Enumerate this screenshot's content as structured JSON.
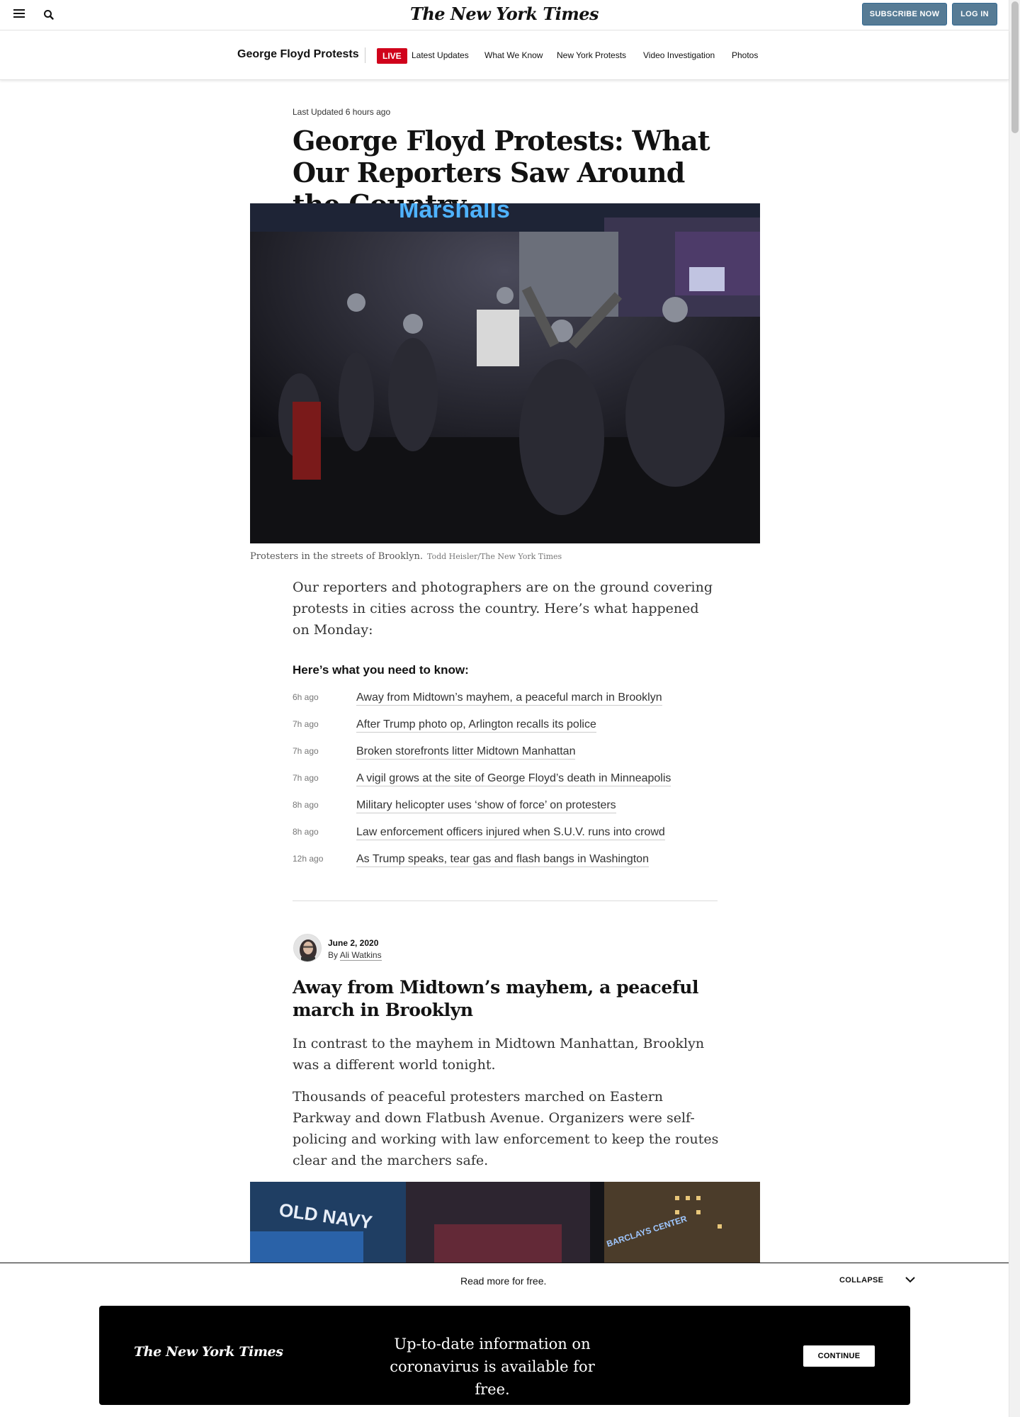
{
  "header": {
    "logo": "The New York Times",
    "subscribe_label": "SUBSCRIBE NOW",
    "login_label": "LOG IN"
  },
  "section_nav": {
    "title": "George Floyd Protests",
    "live_label": "LIVE",
    "links": [
      "Latest Updates",
      "What We Know",
      "New York Protests",
      "Video Investigation",
      "Photos"
    ]
  },
  "article": {
    "last_updated_prefix": "Last Updated",
    "last_updated_value": "6 hours ago",
    "headline": "George Floyd Protests: What Our Reporters Saw Around the Country",
    "caption": "Protesters in the streets of Brooklyn.",
    "credit": "Todd Heisler/The New York Times",
    "lede": "Our reporters and photographers are on the ground covering protests in cities across the country. Here’s what happened on Monday:",
    "need_to_know_title": "Here’s what you need to know:",
    "updates": [
      {
        "time": "6h ago",
        "text": "Away from Midtown’s mayhem, a peaceful march in Brooklyn"
      },
      {
        "time": "7h ago",
        "text": "After Trump photo op, Arlington recalls its police"
      },
      {
        "time": "7h ago",
        "text": "Broken storefronts litter Midtown Manhattan"
      },
      {
        "time": "7h ago",
        "text": "A vigil grows at the site of George Floyd’s death in Minneapolis"
      },
      {
        "time": "8h ago",
        "text": "Military helicopter uses ‘show of force’ on protesters"
      },
      {
        "time": "8h ago",
        "text": "Law enforcement officers injured when S.U.V. runs into crowd"
      },
      {
        "time": "12h ago",
        "text": "As Trump speaks, tear gas and flash bangs in Washington"
      }
    ]
  },
  "post": {
    "date": "June 2, 2020",
    "by": "By",
    "author": "Ali Watkins",
    "title": "Away from Midtown’s mayhem, a peaceful march in Brooklyn",
    "paragraphs": [
      "In contrast to the mayhem in Midtown Manhattan, Brooklyn was a different world tonight.",
      "Thousands of peaceful protesters marched on Eastern Parkway and down Flatbush Avenue. Organizers were self-policing and working with law enforcement to keep the routes clear and the marchers safe."
    ],
    "photo_signs": [
      "OLD NAVY",
      "BARCLAYS CENTER"
    ]
  },
  "bottom_bar": {
    "read_more": "Read more for free.",
    "collapse_label": "COLLAPSE",
    "promo_logo": "The New York Times",
    "promo_text": "Up-to-date information on coronavirus is available for free.",
    "continue_label": "CONTINUE"
  },
  "colors": {
    "live_red": "#d0021b",
    "button_blue": "#567b95"
  }
}
